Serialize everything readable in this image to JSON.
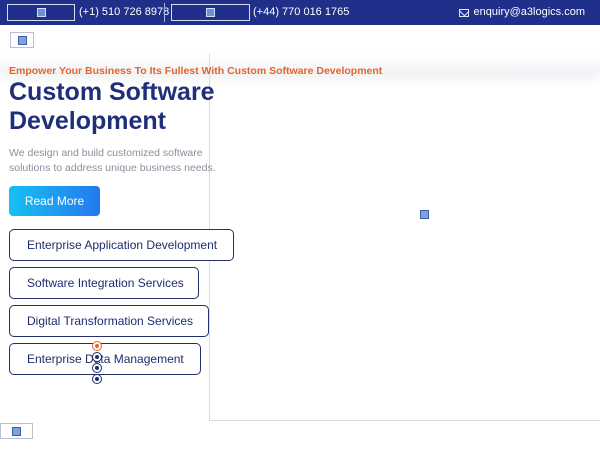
{
  "topbar": {
    "phone_us": "(+1) 510 726 8978",
    "phone_uk": "(+44) 770 016 1765",
    "email": "enquiry@a3logics.com",
    "background": "#1f2f8a",
    "flag_icon": "flag-image-placeholder",
    "mail_icon": "envelope-icon"
  },
  "header": {
    "logo_icon": "broken-image-placeholder"
  },
  "hero": {
    "tagline": "Empower Your Business To Its Fullest With Custom Software Development",
    "title": "Custom Software Development",
    "description": "We design and build customized software solutions to address unique business needs.",
    "cta_label": "Read More",
    "accent_color": "#e0662a",
    "title_color": "#1f2f7a"
  },
  "services": [
    {
      "label": "Enterprise Application Development"
    },
    {
      "label": "Software Integration Services"
    },
    {
      "label": "Digital Transformation Services"
    },
    {
      "label": "Enterprise Data Management"
    }
  ],
  "slider": {
    "dot_count": 4,
    "active_index": 0
  }
}
